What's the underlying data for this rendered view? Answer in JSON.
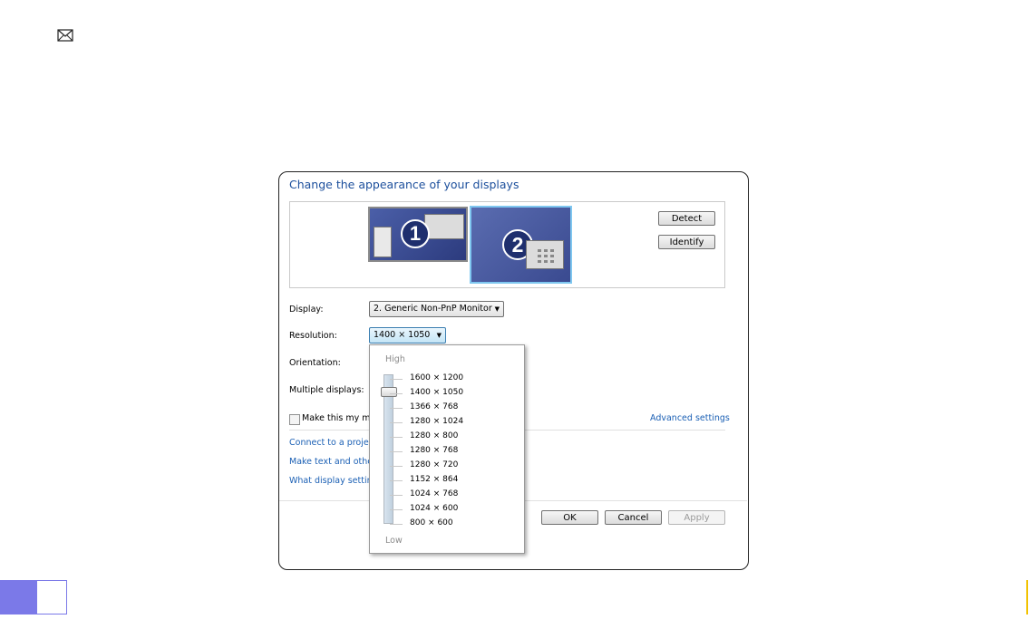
{
  "dialog": {
    "title": "Change the appearance of your displays",
    "monitors": [
      {
        "number": "1"
      },
      {
        "number": "2"
      }
    ],
    "detect_label": "Detect",
    "identify_label": "Identify",
    "display_label": "Display:",
    "display_value": "2. Generic Non-PnP Monitor",
    "resolution_label": "Resolution:",
    "resolution_value": "1400 × 1050",
    "orientation_label": "Orientation:",
    "multiple_displays_label": "Multiple displays:",
    "main_display_checkbox_label": "Make this my ma",
    "advanced_settings_link": "Advanced settings",
    "links": [
      "Connect to a projec",
      "Make text and other",
      "What display setting"
    ],
    "ok_label": "OK",
    "cancel_label": "Cancel",
    "apply_label": "Apply"
  },
  "resolution_popup": {
    "high_label": "High",
    "low_label": "Low",
    "options": [
      "1600 × 1200",
      "1400 × 1050",
      "1366 × 768",
      "1280 × 1024",
      "1280 × 800",
      "1280 × 768",
      "1280 × 720",
      "1152 × 864",
      "1024 × 768",
      "1024 × 600",
      "800 × 600"
    ],
    "selected": "1400 × 1050"
  },
  "colors": {
    "link": "#1a5fb4",
    "title": "#1c4f9c",
    "taskbar_accent": "#7b79e8"
  },
  "icons": {
    "top_left": "mail-icon"
  }
}
